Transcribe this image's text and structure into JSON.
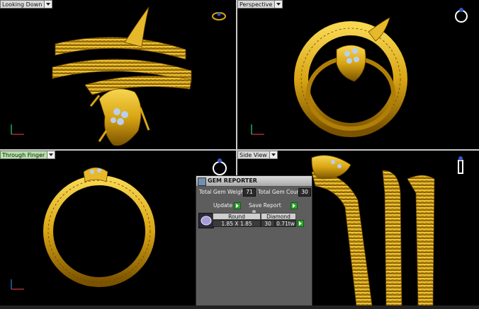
{
  "viewports": {
    "top_left": {
      "label": "Looking Down"
    },
    "top_right": {
      "label": "Perspective"
    },
    "bottom_left": {
      "label": "Through Finger"
    },
    "bottom_right": {
      "label": "Side View"
    }
  },
  "gem_reporter": {
    "title": "GEM REPORTER",
    "total_gem_weight_label": "Total Gem Weight",
    "total_gem_weight": "71",
    "total_gem_count_label": "Total Gem Count",
    "total_gem_count": "30",
    "update_label": "Update",
    "save_report_label": "Save Report",
    "table": {
      "shape_header": "Round",
      "material_header": "Diamond",
      "size": "1.85 X 1.85",
      "count": "30",
      "weight": "0.71tw"
    }
  },
  "colors": {
    "gold": "#d9a514",
    "gold_dark": "#8a5e00",
    "diamond": "#b8cfee"
  },
  "icons": [
    "axis-triad-icon",
    "ring-preview-icon",
    "gem-thumbnail-icon",
    "go-arrow-icon"
  ]
}
